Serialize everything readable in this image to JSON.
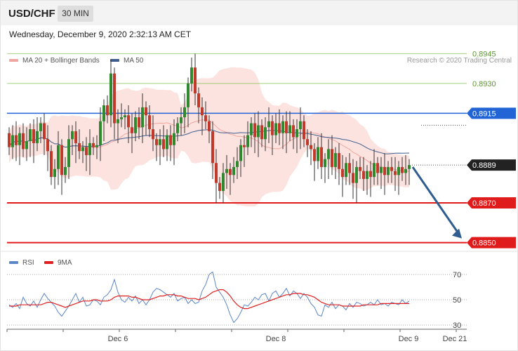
{
  "header": {
    "symbol": "USD/CHF",
    "timeframe": "30 MIN"
  },
  "timestamp": "Wednesday, December 9, 2020 2:32:13 AM CET",
  "legend": {
    "ma20_label": "MA 20 + Bollinger Bands",
    "ma20_color": "#f0a6a0",
    "ma50_label": "MA 50",
    "ma50_color": "#3f5e8f",
    "rsi_label": "RSI",
    "rsi_color": "#5b86c8",
    "ma9_label": "9MA",
    "ma9_color": "#e02020"
  },
  "credit": "Research © 2020 Trading Central",
  "chart_data": [
    {
      "type": "candlestick",
      "name": "USD/CHF 30 MIN",
      "ylim": [
        0.884,
        0.8955
      ],
      "x_tick_labels": [
        "Dec 6",
        "Dec 8",
        "Dec 9",
        "Dec 21"
      ],
      "current_price": "0.8889",
      "levels": [
        {
          "value": 0.8945,
          "label": "0.8945",
          "kind": "resistance",
          "color": "#7cbf4a"
        },
        {
          "value": 0.893,
          "label": "0.8930",
          "kind": "resistance",
          "color": "#7cbf4a"
        },
        {
          "value": 0.8915,
          "label": "0.8915",
          "kind": "pivot",
          "color": "#2264d6"
        },
        {
          "value": 0.887,
          "label": "0.8870",
          "kind": "support",
          "color": "#e01b1b"
        },
        {
          "value": 0.885,
          "label": "0.8850",
          "kind": "support",
          "color": "#e01b1b"
        }
      ],
      "projection": {
        "from": 0.8888,
        "to": 0.885
      },
      "candles": [
        [
          0.8905,
          0.8898
        ],
        [
          0.8898,
          0.8904
        ],
        [
          0.8904,
          0.8899
        ],
        [
          0.8899,
          0.8905
        ],
        [
          0.8905,
          0.8897
        ],
        [
          0.8897,
          0.8901
        ],
        [
          0.8901,
          0.8907
        ],
        [
          0.8907,
          0.89
        ],
        [
          0.89,
          0.8906
        ],
        [
          0.8906,
          0.891
        ],
        [
          0.891,
          0.8902
        ],
        [
          0.8902,
          0.8896
        ],
        [
          0.8896,
          0.8883
        ],
        [
          0.8883,
          0.8887
        ],
        [
          0.8887,
          0.8899
        ],
        [
          0.8899,
          0.8884
        ],
        [
          0.8884,
          0.8888
        ],
        [
          0.8888,
          0.8902
        ],
        [
          0.8902,
          0.8906
        ],
        [
          0.8906,
          0.89
        ],
        [
          0.89,
          0.8896
        ],
        [
          0.8896,
          0.8898
        ],
        [
          0.8898,
          0.8894
        ],
        [
          0.8894,
          0.89
        ],
        [
          0.89,
          0.8898
        ],
        [
          0.8898,
          0.8899
        ],
        [
          0.8899,
          0.8911
        ],
        [
          0.8911,
          0.8919
        ],
        [
          0.8919,
          0.8914
        ],
        [
          0.8914,
          0.8935
        ],
        [
          0.8935,
          0.891
        ],
        [
          0.891,
          0.8912
        ],
        [
          0.8912,
          0.8913
        ],
        [
          0.8913,
          0.8914
        ],
        [
          0.8914,
          0.8908
        ],
        [
          0.8908,
          0.8905
        ],
        [
          0.8905,
          0.8913
        ],
        [
          0.8913,
          0.8908
        ],
        [
          0.8908,
          0.8918
        ],
        [
          0.8918,
          0.8914
        ],
        [
          0.8914,
          0.8907
        ],
        [
          0.8907,
          0.8902
        ],
        [
          0.8902,
          0.8899
        ],
        [
          0.8899,
          0.8902
        ],
        [
          0.8902,
          0.8897
        ],
        [
          0.8897,
          0.8904
        ],
        [
          0.8904,
          0.8899
        ],
        [
          0.8899,
          0.8905
        ],
        [
          0.8905,
          0.891
        ],
        [
          0.891,
          0.8913
        ],
        [
          0.8913,
          0.8918
        ],
        [
          0.8918,
          0.893
        ],
        [
          0.893,
          0.8938
        ],
        [
          0.8938,
          0.8925
        ],
        [
          0.8925,
          0.8918
        ],
        [
          0.8918,
          0.8914
        ],
        [
          0.8914,
          0.8911
        ],
        [
          0.8911,
          0.8906
        ],
        [
          0.8906,
          0.889
        ],
        [
          0.889,
          0.888
        ],
        [
          0.888,
          0.8876
        ],
        [
          0.8876,
          0.8885
        ],
        [
          0.8885,
          0.8887
        ],
        [
          0.8887,
          0.8884
        ],
        [
          0.8884,
          0.8888
        ],
        [
          0.8888,
          0.8891
        ],
        [
          0.8891,
          0.8899
        ],
        [
          0.8899,
          0.8898
        ],
        [
          0.8898,
          0.8904
        ],
        [
          0.8904,
          0.891
        ],
        [
          0.891,
          0.8903
        ],
        [
          0.8903,
          0.8909
        ],
        [
          0.8909,
          0.8902
        ],
        [
          0.8902,
          0.8908
        ],
        [
          0.8908,
          0.8911
        ],
        [
          0.8911,
          0.8904
        ],
        [
          0.8904,
          0.891
        ],
        [
          0.891,
          0.8905
        ],
        [
          0.8905,
          0.8911
        ],
        [
          0.8911,
          0.8905
        ],
        [
          0.8905,
          0.8909
        ],
        [
          0.8909,
          0.8903
        ],
        [
          0.8903,
          0.8907
        ],
        [
          0.8907,
          0.8911
        ],
        [
          0.8911,
          0.8902
        ],
        [
          0.8902,
          0.8899
        ],
        [
          0.8899,
          0.8897
        ],
        [
          0.8897,
          0.8891
        ],
        [
          0.8891,
          0.8898
        ],
        [
          0.8898,
          0.8888
        ],
        [
          0.8888,
          0.8892
        ],
        [
          0.8892,
          0.8897
        ],
        [
          0.8897,
          0.8888
        ],
        [
          0.8888,
          0.8895
        ],
        [
          0.8895,
          0.8887
        ],
        [
          0.8887,
          0.8883
        ],
        [
          0.8883,
          0.889
        ],
        [
          0.889,
          0.8885
        ],
        [
          0.8885,
          0.888
        ],
        [
          0.888,
          0.8888
        ],
        [
          0.8888,
          0.8886
        ],
        [
          0.8886,
          0.8882
        ],
        [
          0.8882,
          0.8886
        ],
        [
          0.8886,
          0.8883
        ],
        [
          0.8883,
          0.889
        ],
        [
          0.889,
          0.8885
        ],
        [
          0.8885,
          0.8888
        ],
        [
          0.8888,
          0.8884
        ],
        [
          0.8884,
          0.8888
        ],
        [
          0.8888,
          0.8886
        ],
        [
          0.8886,
          0.8884
        ],
        [
          0.8884,
          0.8888
        ],
        [
          0.8888,
          0.8885
        ],
        [
          0.8885,
          0.8887
        ],
        [
          0.8887,
          0.8889
        ]
      ]
    },
    {
      "type": "line",
      "name": "RSI panel",
      "ylim": [
        20,
        80
      ],
      "y_tick_labels": [
        "70",
        "50",
        "30"
      ],
      "series": [
        {
          "name": "RSI",
          "values": [
            46,
            44,
            47,
            43,
            52,
            47,
            45,
            49,
            44,
            50,
            55,
            51,
            48,
            45,
            40,
            37,
            41,
            45,
            50,
            55,
            48,
            52,
            45,
            46,
            50,
            49,
            46,
            52,
            54,
            58,
            66,
            56,
            50,
            48,
            52,
            49,
            53,
            47,
            50,
            46,
            50,
            56,
            59,
            58,
            56,
            54,
            52,
            55,
            49,
            51,
            52,
            47,
            50,
            47,
            48,
            57,
            62,
            70,
            72,
            60,
            56,
            52,
            46,
            38,
            32,
            35,
            40,
            46,
            45,
            48,
            52,
            50,
            54,
            55,
            49,
            55,
            57,
            52,
            55,
            59,
            53,
            57,
            55,
            51,
            55,
            52,
            47,
            44,
            38,
            37,
            46,
            44,
            48,
            43,
            46,
            45,
            42,
            47,
            44,
            48,
            47,
            45,
            46,
            48,
            46,
            50,
            46,
            47,
            45,
            48,
            47,
            46,
            50,
            47,
            49
          ]
        },
        {
          "name": "9MA",
          "values": [
            45,
            45,
            45,
            46,
            46,
            46,
            46,
            46,
            46,
            46,
            47,
            48,
            48,
            47,
            46,
            45,
            44,
            45,
            46,
            47,
            48,
            49,
            49,
            49,
            50,
            50,
            49,
            49,
            49,
            50,
            52,
            53,
            53,
            53,
            53,
            52,
            52,
            51,
            50,
            50,
            50,
            51,
            52,
            53,
            53,
            54,
            54,
            54,
            53,
            53,
            52,
            51,
            51,
            51,
            50,
            51,
            52,
            54,
            56,
            57,
            58,
            58,
            56,
            53,
            49,
            46,
            44,
            43,
            43,
            44,
            45,
            46,
            47,
            48,
            49,
            50,
            51,
            52,
            53,
            54,
            54,
            55,
            55,
            55,
            54,
            54,
            53,
            52,
            50,
            48,
            47,
            46,
            46,
            46,
            46,
            45,
            45,
            45,
            45,
            45,
            45,
            46,
            46,
            46,
            46,
            46,
            47,
            47,
            47,
            47,
            47,
            47,
            47,
            47,
            47
          ]
        }
      ]
    }
  ]
}
